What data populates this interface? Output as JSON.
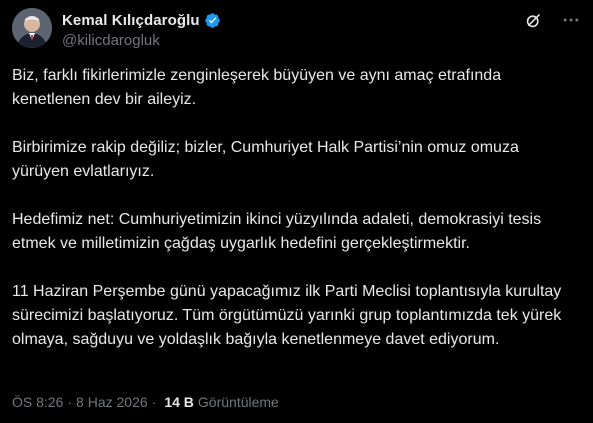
{
  "author": {
    "display_name": "Kemal Kılıçdaroğlu",
    "handle": "@kilicdarogluk",
    "verified": true
  },
  "header_icons": [
    "grok-icon",
    "more-icon"
  ],
  "tweet": {
    "paragraphs": [
      "Biz, farklı fikirlerimizle zenginleşerek büyüyen ve aynı amaç etrafında kenetlenen dev bir aileyiz.",
      "Birbirimize rakip değiliz; bizler, Cumhuriyet Halk Partisi’nin omuz omuza yürüyen evlatlarıyız.",
      "Hedefimiz net: Cumhuriyetimizin ikinci yüzyılında adaleti, demokrasiyi tesis etmek ve milletimizin çağdaş uygarlık hedefini gerçekleştirmektir.",
      "11 Haziran Perşembe günü yapacağımız ilk Parti Meclisi toplantısıyla kurultay sürecimizi başlatıyoruz. Tüm örgütümüzü yarınki grup toplantımızda tek yürek olmaya, sağduyu ve yoldaşlık bağıyla kenetlenmeye davet ediyorum."
    ]
  },
  "meta": {
    "time": "ÖS 8:26",
    "separator1": "·",
    "date": "8 Haz 2026",
    "separator2": "·",
    "views_count": "14 B",
    "views_label": "Görüntüleme"
  },
  "colors": {
    "background": "#000000",
    "text": "#e7e9ea",
    "muted": "#71767b",
    "verified": "#1d9bf0"
  }
}
